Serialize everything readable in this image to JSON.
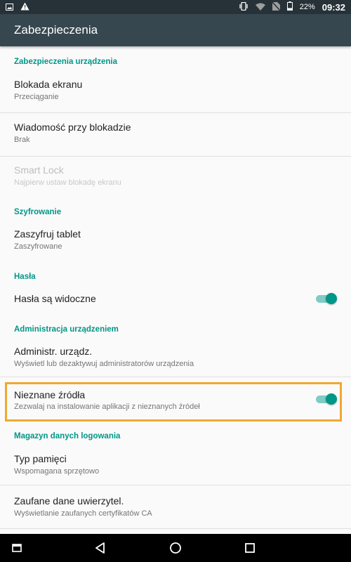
{
  "status_bar": {
    "battery": "22%",
    "time": "09:32",
    "icons_left": [
      "image-icon",
      "warning-icon"
    ],
    "icons_right": [
      "vibrate-icon",
      "wifi-icon",
      "no-sim-icon",
      "battery-icon"
    ]
  },
  "app_bar": {
    "title": "Zabezpieczenia"
  },
  "sections": {
    "device_security": {
      "header": "Zabezpieczenia urządzenia"
    },
    "encryption": {
      "header": "Szyfrowanie"
    },
    "passwords": {
      "header": "Hasła"
    },
    "device_admin": {
      "header": "Administracja urządzeniem"
    },
    "credential_storage": {
      "header": "Magazyn danych logowania"
    }
  },
  "items": {
    "screen_lock": {
      "title": "Blokada ekranu",
      "summary": "Przeciąganie"
    },
    "lock_message": {
      "title": "Wiadomość przy blokadzie",
      "summary": "Brak"
    },
    "smart_lock": {
      "title": "Smart Lock",
      "summary": "Najpierw ustaw blokadę ekranu",
      "enabled": false
    },
    "encrypt_tablet": {
      "title": "Zaszyfruj tablet",
      "summary": "Zaszyfrowane"
    },
    "show_passwords": {
      "title": "Hasła są widoczne",
      "toggle_on": true
    },
    "device_admins": {
      "title": "Administr. urządz.",
      "summary": "Wyświetl lub dezaktywuj administratorów urządzenia"
    },
    "unknown_sources": {
      "title": "Nieznane źródła",
      "summary": "Zezwalaj na instalowanie aplikacji z nieznanych źródeł",
      "toggle_on": true,
      "highlighted": true
    },
    "storage_type": {
      "title": "Typ pamięci",
      "summary": "Wspomagana sprzętowo"
    },
    "trusted_credentials": {
      "title": "Zaufane dane uwierzytel.",
      "summary": "Wyświetlanie zaufanych certyfikatów CA"
    }
  },
  "navigation_bar": {
    "buttons": [
      "recents-icon",
      "back-icon",
      "home-icon",
      "overview-icon"
    ]
  },
  "colors": {
    "accent": "#009688",
    "app_bar": "#37474f",
    "status_bar": "#263238",
    "highlight_border": "#f0a830"
  }
}
